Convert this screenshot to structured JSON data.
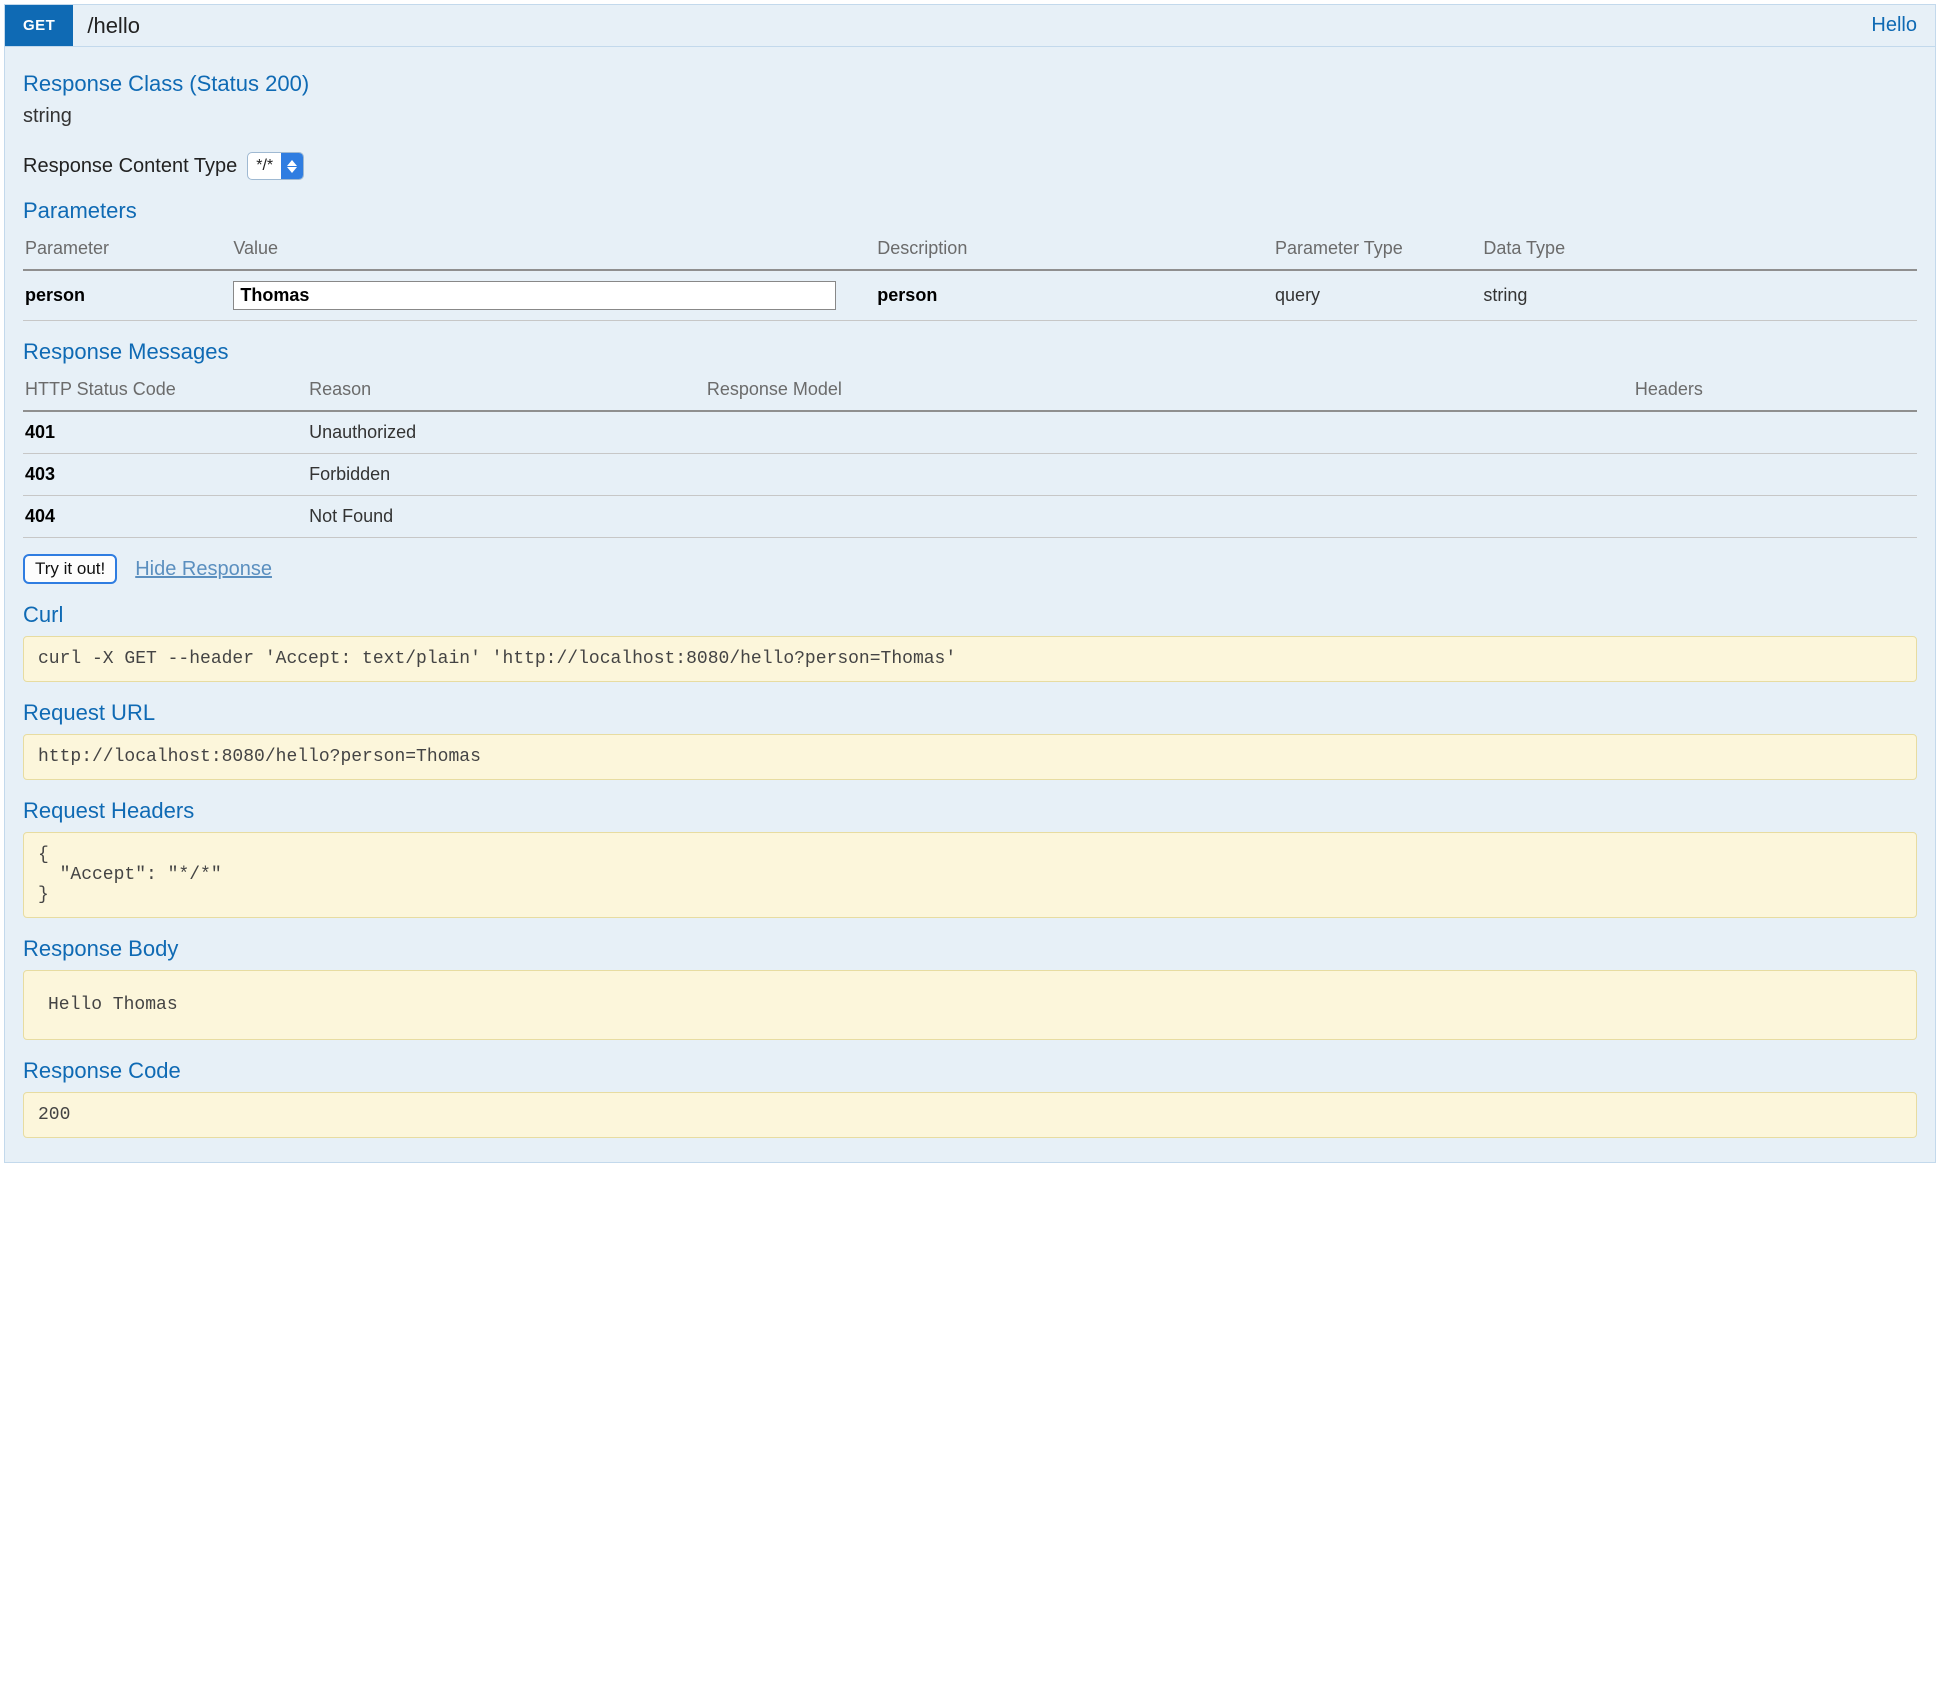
{
  "operation": {
    "method": "GET",
    "path": "/hello",
    "tag": "Hello"
  },
  "response_class": {
    "heading": "Response Class (Status 200)",
    "type": "string"
  },
  "content_type": {
    "label": "Response Content Type",
    "selected": "*/*"
  },
  "parameters": {
    "heading": "Parameters",
    "headers": {
      "parameter": "Parameter",
      "value": "Value",
      "description": "Description",
      "param_type": "Parameter Type",
      "data_type": "Data Type"
    },
    "rows": [
      {
        "name": "person",
        "value": "Thomas",
        "description": "person",
        "param_type": "query",
        "data_type": "string"
      }
    ]
  },
  "response_messages": {
    "heading": "Response Messages",
    "headers": {
      "status": "HTTP Status Code",
      "reason": "Reason",
      "model": "Response Model",
      "headers": "Headers"
    },
    "rows": [
      {
        "status": "401",
        "reason": "Unauthorized"
      },
      {
        "status": "403",
        "reason": "Forbidden"
      },
      {
        "status": "404",
        "reason": "Not Found"
      }
    ]
  },
  "actions": {
    "try": "Try it out!",
    "hide": "Hide Response"
  },
  "result": {
    "curl_heading": "Curl",
    "curl": "curl -X GET --header 'Accept: text/plain' 'http://localhost:8080/hello?person=Thomas'",
    "request_url_heading": "Request URL",
    "request_url": "http://localhost:8080/hello?person=Thomas",
    "request_headers_heading": "Request Headers",
    "request_headers": "{\n  \"Accept\": \"*/*\"\n}",
    "response_body_heading": "Response Body",
    "response_body": "Hello Thomas",
    "response_code_heading": "Response Code",
    "response_code": "200"
  }
}
